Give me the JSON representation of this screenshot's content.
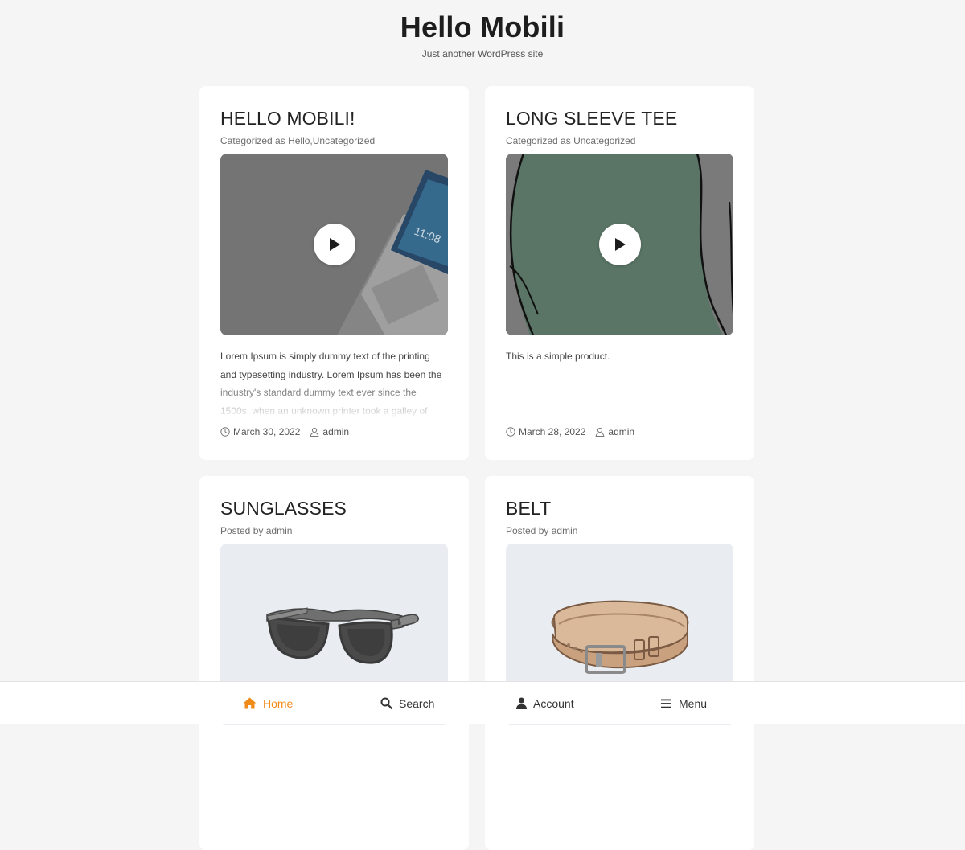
{
  "site": {
    "title": "Hello Mobili",
    "tagline": "Just another WordPress site"
  },
  "posts": [
    {
      "title": "HELLO MOBILI!",
      "meta_prefix": "Categorized as",
      "meta_value": "Hello,Uncategorized",
      "media": "video-laptop",
      "excerpt": "Lorem Ipsum is simply dummy text of the printing and typesetting industry. Lorem Ipsum has been the industry's standard dummy text ever since the 1500s, when an unknown printer took a galley of",
      "date": "March 30, 2022",
      "author": "admin"
    },
    {
      "title": "LONG SLEEVE TEE",
      "meta_prefix": "Categorized as",
      "meta_value": "Uncategorized",
      "media": "video-tee",
      "excerpt": "This is a simple product.",
      "date": "March 28, 2022",
      "author": "admin"
    },
    {
      "title": "SUNGLASSES",
      "meta_prefix": "Posted by",
      "meta_value": "admin",
      "media": "image-sunglasses"
    },
    {
      "title": "BELT",
      "meta_prefix": "Posted by",
      "meta_value": "admin",
      "media": "image-belt"
    }
  ],
  "bottom_nav": [
    {
      "label": "Home",
      "icon": "home-icon",
      "active": true
    },
    {
      "label": "Search",
      "icon": "search-icon",
      "active": false
    },
    {
      "label": "Account",
      "icon": "user-icon",
      "active": false
    },
    {
      "label": "Menu",
      "icon": "menu-icon",
      "active": false
    }
  ],
  "colors": {
    "accent": "#f08a18",
    "background": "#f5f5f5",
    "card": "#ffffff",
    "image_bg": "#e9edf2"
  }
}
